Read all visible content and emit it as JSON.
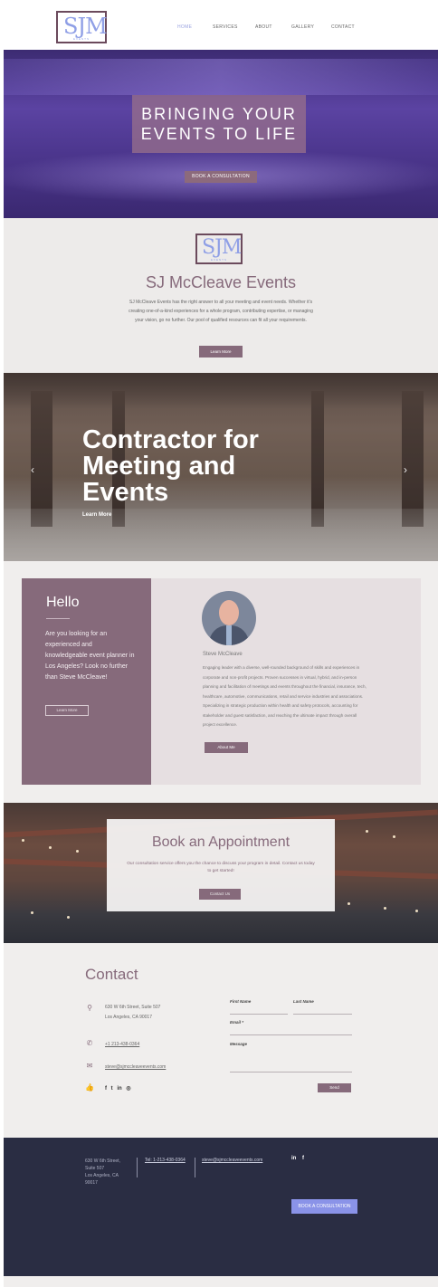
{
  "brand": {
    "logo_text": "SJM",
    "logo_sub": "EVENTS"
  },
  "nav": {
    "items": [
      "HOME",
      "SERVICES",
      "ABOUT",
      "GALLERY",
      "CONTACT"
    ],
    "active": "HOME"
  },
  "hero": {
    "title_line1": "BRINGING YOUR",
    "title_line2": "EVENTS TO LIFE",
    "cta": "BOOK A CONSULTATION"
  },
  "about": {
    "title": "SJ McCleave Events",
    "text": "SJ McCleave Events has the right answer to all your meeting and event needs.  Whether it's creating one-of-a-kind experiences for a whole program, contributing expertise, or managing your vision, go no further.  Our pool of qualified resources can fit all your requirements.",
    "button": "Learn More"
  },
  "ballroom": {
    "title_line1": "Contractor for",
    "title_line2": "Meeting and",
    "title_line3": "Events",
    "link": "Learn More",
    "prev": "‹",
    "next": "›"
  },
  "hello": {
    "title": "Hello",
    "text": "Are you looking for an experienced and knowledgeable event planner in Los Angeles? Look no further than Steve McCleave!",
    "button": "Learn More",
    "person_name": "Steve McCleave",
    "bio": "Engaging leader with a diverse, well-rounded background of skills and experiences in corporate and non-profit projects. Proven successes in virtual, hybrid, and in-person planning and facilitation of meetings and events throughout the financial, insurance, tech, healthcare, automotive, communications, retail and service industries and associations. Specializing in strategic production within health and safety protocols, accounting for stakeholder and guest satisfaction, and reaching the ultimate impact through overall project excellence.",
    "about_button": "About Me"
  },
  "book": {
    "title": "Book an Appointment",
    "text": "Our consultation service offers you the chance to discuss your program in detail. Contact us today to get started!",
    "button": "Contact Us"
  },
  "contact": {
    "title": "Contact",
    "address_line1": "630 W 6th Street, Suite 507",
    "address_line2": "Los Angeles, CA 90017",
    "phone": "+1 213-438-0364",
    "email": "steve@sjmccleaveevents.com",
    "social": [
      "f",
      "t",
      "in",
      "◎"
    ],
    "form": {
      "first_name": "First Name",
      "last_name": "Last Name",
      "email": "Email *",
      "message": "Message",
      "send": "Send"
    }
  },
  "footer": {
    "addr_line1": "630 W 6th Street,",
    "addr_line2": "Suite 507",
    "addr_line3": "Los Angeles, CA",
    "addr_line4": "90017",
    "tel": "Tel: 1-213-438-0364",
    "email": "steve@sjmccleaveevents.com",
    "social": [
      "in",
      "f"
    ],
    "cta": "BOOK A CONSULTATION"
  },
  "colors": {
    "accent": "#866a7b",
    "brand_blue": "#8f9fe6",
    "footer_bg": "#2a2d43"
  }
}
